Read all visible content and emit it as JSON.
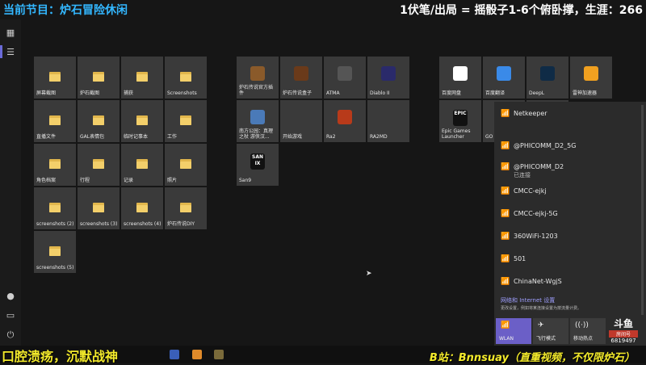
{
  "overlay": {
    "left_text": "当前节目：炉石冒险休闲",
    "right_text": "1伏笔/出局 = 摇骰子1-6个俯卧撑，生涯：266",
    "bottom_left": "口腔溃疡，沉默战神",
    "bottom_right": "B站：Bnnsuay（直重视频，不仅限炉石）"
  },
  "group1": {
    "tiles": [
      {
        "label": "屏幕截图",
        "icon": "folder-icon"
      },
      {
        "label": "炉石截图",
        "icon": "folder-icon"
      },
      {
        "label": "捕获",
        "icon": "folder-icon"
      },
      {
        "label": "Screenshots",
        "icon": "folder-icon"
      },
      {
        "label": "直播文件",
        "icon": "folder-icon"
      },
      {
        "label": "GAL表情包",
        "icon": "folder-icon"
      },
      {
        "label": "临时记事本",
        "icon": "folder-icon"
      },
      {
        "label": "工作",
        "icon": "folder-icon"
      },
      {
        "label": "角色档案",
        "icon": "folder-icon"
      },
      {
        "label": "行程",
        "icon": "folder-icon"
      },
      {
        "label": "记录",
        "icon": "folder-icon"
      },
      {
        "label": "照片",
        "icon": "folder-icon"
      },
      {
        "label": "screenshots (2)",
        "icon": "folder-icon"
      },
      {
        "label": "screenshots (3)",
        "icon": "folder-icon"
      },
      {
        "label": "screenshots (4)",
        "icon": "folder-icon"
      },
      {
        "label": "炉石传说DIY",
        "icon": "folder-icon"
      },
      {
        "label": "screenshots (5)",
        "icon": "folder-icon"
      }
    ]
  },
  "group2": {
    "tiles": [
      {
        "label": "炉石传说官方插件",
        "icon": "hearthstone-plugin-icon"
      },
      {
        "label": "炉石传说盒子",
        "icon": "hearthstone-box-icon"
      },
      {
        "label": "ATMA",
        "icon": "atma-icon"
      },
      {
        "label": "Diablo II",
        "icon": "diablo-icon"
      },
      {
        "label": "南方公园：真理之杖 游侠汉...",
        "icon": "south-park-icon"
      },
      {
        "label": "开始游戏",
        "icon": "start-game-icon"
      },
      {
        "label": "Ra2",
        "icon": "ra2-icon"
      },
      {
        "label": "RA2MD",
        "icon": "ra2md-icon"
      },
      {
        "label": "San9",
        "icon": "san9-icon",
        "icon_text": "SAN IX"
      }
    ]
  },
  "group3": {
    "tiles": [
      {
        "label": "百度网盘",
        "icon": "baidu-netdisk-icon"
      },
      {
        "label": "百度翻译",
        "icon": "baidu-translate-icon"
      },
      {
        "label": "DeepL",
        "icon": "deepl-icon"
      },
      {
        "label": "雷神加速器",
        "icon": "leishen-icon"
      },
      {
        "label": "Epic Games Launcher",
        "icon": "epic-icon",
        "icon_text": "EPIC"
      },
      {
        "label": "GO",
        "icon": "go-icon"
      },
      {
        "label": "腾讯QQ",
        "icon": "qq-icon"
      }
    ]
  },
  "wifi": {
    "networks": [
      {
        "name": "Netkeeper",
        "sub": ""
      },
      {
        "name": "@PHICOMM_D2_5G",
        "sub": ""
      },
      {
        "name": "@PHICOMM_D2",
        "sub": "已连接"
      },
      {
        "name": "CMCC-ejkj",
        "sub": ""
      },
      {
        "name": "CMCC-ejkj-5G",
        "sub": ""
      },
      {
        "name": "360WiFi-1203",
        "sub": ""
      },
      {
        "name": "501",
        "sub": ""
      },
      {
        "name": "ChinaNet-WgjS",
        "sub": ""
      }
    ],
    "settings_title": "网络和 Internet 设置",
    "settings_desc": "更改设置，例如将某连接设置为按流量计费。",
    "quick": [
      {
        "label": "WLAN",
        "active": true
      },
      {
        "label": "飞行模式",
        "active": false
      },
      {
        "label": "移动热点",
        "active": false
      }
    ],
    "accent": "#6b5fc7"
  },
  "douyu": {
    "logo": "斗鱼",
    "sub": "房间号",
    "room": "6819497"
  }
}
